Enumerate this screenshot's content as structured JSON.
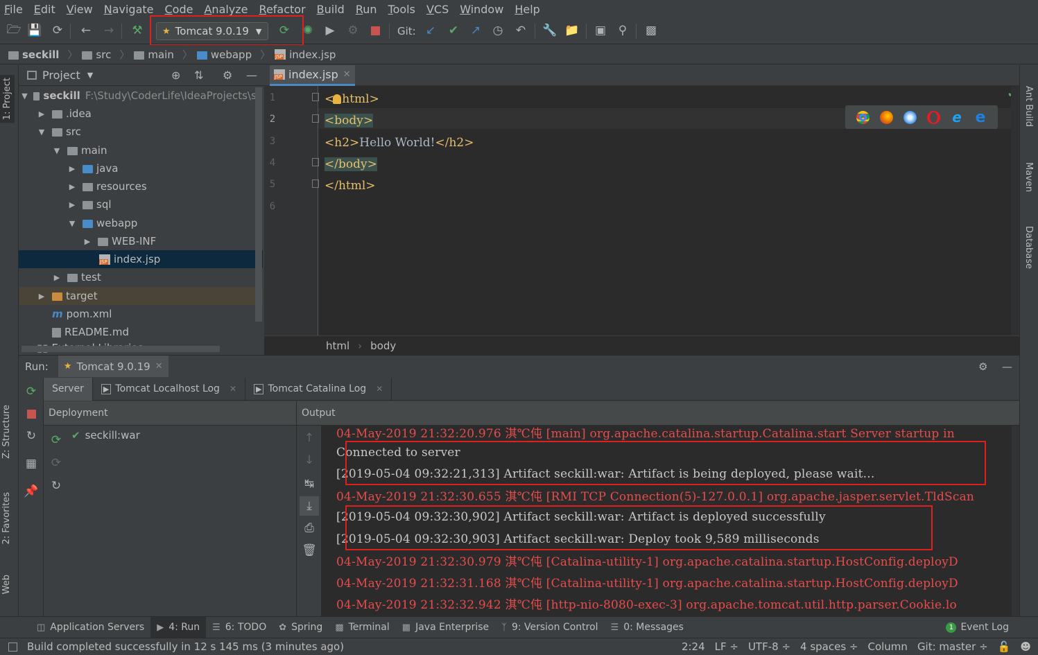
{
  "menu": [
    "File",
    "Edit",
    "View",
    "Navigate",
    "Code",
    "Analyze",
    "Refactor",
    "Build",
    "Run",
    "Tools",
    "VCS",
    "Window",
    "Help"
  ],
  "toolbar": {
    "run_config": "Tomcat 9.0.19",
    "git_label": "Git:"
  },
  "breadcrumb": [
    "seckill",
    "src",
    "main",
    "webapp",
    "index.jsp"
  ],
  "project": {
    "title": "Project",
    "root_name": "seckill",
    "root_path": "F:\\Study\\CoderLife\\IdeaProjects\\se",
    "items": [
      ".idea",
      "src",
      "main",
      "java",
      "resources",
      "sql",
      "webapp",
      "WEB-INF",
      "index.jsp",
      "test",
      "target",
      "pom.xml",
      "README.md",
      "External Libraries"
    ]
  },
  "editor": {
    "tab": "index.jsp",
    "line_numbers": [
      "1",
      "2",
      "3",
      "4",
      "5",
      "6"
    ],
    "code": {
      "l1_open": "<",
      "l1_tag": "html>",
      "l2": "<body>",
      "l3_open": "<h2>",
      "l3_text": "Hello World!",
      "l3_close": "</h2>",
      "l4": "</body>",
      "l5": "</html>"
    },
    "crumbs": [
      "html",
      "body"
    ]
  },
  "run": {
    "label": "Run:",
    "config": "Tomcat 9.0.19",
    "tabs": [
      "Server",
      "Tomcat Localhost Log",
      "Tomcat Catalina Log"
    ],
    "deployment_header": "Deployment",
    "output_header": "Output",
    "artifact": "seckill:war",
    "console": [
      {
        "text": "04-May-2019 21:32:20.976 淇℃伅 [main] org.apache.catalina.startup.Catalina.start Server startup in",
        "color": "red"
      },
      {
        "text": "Connected to server",
        "color": "white"
      },
      {
        "text": "[2019-05-04 09:32:21,313] Artifact seckill:war: Artifact is being deployed, please wait...",
        "color": "white"
      },
      {
        "text": "04-May-2019 21:32:30.655 淇℃伅 [RMI TCP Connection(5)-127.0.0.1] org.apache.jasper.servlet.TldScan",
        "color": "red"
      },
      {
        "text": "[2019-05-04 09:32:30,902] Artifact seckill:war: Artifact is deployed successfully",
        "color": "white"
      },
      {
        "text": "[2019-05-04 09:32:30,903] Artifact seckill:war: Deploy took 9,589 milliseconds",
        "color": "white"
      },
      {
        "text": "04-May-2019 21:32:30.979 淇℃伅 [Catalina-utility-1] org.apache.catalina.startup.HostConfig.deployD",
        "color": "red"
      },
      {
        "text": "04-May-2019 21:32:31.168 淇℃伅 [Catalina-utility-1] org.apache.catalina.startup.HostConfig.deployD",
        "color": "red"
      },
      {
        "text": "04-May-2019 21:32:32.942 淇℃伅 [http-nio-8080-exec-3] org.apache.tomcat.util.http.parser.Cookie.lo",
        "color": "red"
      }
    ]
  },
  "left_strip": {
    "project": "1: Project",
    "structure": "Z: Structure",
    "favorites": "2: Favorites",
    "web": "Web"
  },
  "right_strip": {
    "ant": "Ant Build",
    "maven": "Maven",
    "database": "Database"
  },
  "tool_windows": [
    "Application Servers",
    "4: Run",
    "6: TODO",
    "Spring",
    "Terminal",
    "Java Enterprise",
    "9: Version Control",
    "0: Messages",
    "Event Log"
  ],
  "event_log_count": "1",
  "status": {
    "message": "Build completed successfully in 12 s 145 ms (3 minutes ago)",
    "position": "2:24",
    "line_sep": "LF ÷",
    "encoding": "UTF-8 ÷",
    "indent": "4 spaces ÷",
    "column": "Column",
    "git": "Git: master ÷"
  },
  "colors": {
    "accent": "#4a88c7",
    "error_red": "#e84c4c",
    "highlight_box": "#e0201f",
    "success_green": "#59a869"
  }
}
